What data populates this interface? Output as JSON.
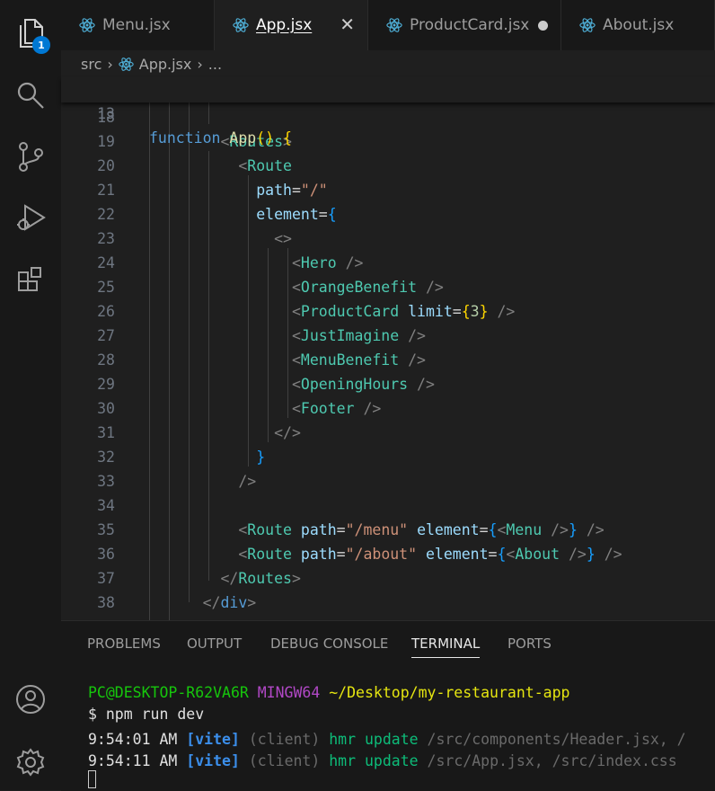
{
  "activity_bar": {
    "explorer_badge": "1"
  },
  "tabs": [
    {
      "label": "Menu.jsx",
      "state": "normal"
    },
    {
      "label": "App.jsx",
      "state": "active"
    },
    {
      "label": "ProductCard.jsx",
      "state": "modified"
    },
    {
      "label": "About.jsx",
      "state": "normal"
    }
  ],
  "breadcrumb": {
    "folder": "src",
    "file": "App.jsx",
    "more": "..."
  },
  "sticky_line": {
    "number": "13",
    "keyword": "function",
    "name": "App",
    "parens": "()",
    "brace": "{"
  },
  "code_lines": [
    {
      "n": "18"
    },
    {
      "n": "19"
    },
    {
      "n": "20"
    },
    {
      "n": "21"
    },
    {
      "n": "22"
    },
    {
      "n": "23"
    },
    {
      "n": "24"
    },
    {
      "n": "25"
    },
    {
      "n": "26"
    },
    {
      "n": "27"
    },
    {
      "n": "28"
    },
    {
      "n": "29"
    },
    {
      "n": "30"
    },
    {
      "n": "31"
    },
    {
      "n": "32"
    },
    {
      "n": "33"
    },
    {
      "n": "34"
    },
    {
      "n": "35"
    },
    {
      "n": "36"
    },
    {
      "n": "37"
    },
    {
      "n": "38"
    }
  ],
  "code": {
    "routes_open": "Routes",
    "route": "Route",
    "path_attr": "path",
    "root_path": "\"/\"",
    "element_attr": "element",
    "hero": "Hero",
    "orange": "OrangeBenefit",
    "product": "ProductCard",
    "limit_attr": "limit",
    "limit_val": "3",
    "imagine": "JustImagine",
    "menu_benefit": "MenuBenefit",
    "opening": "OpeningHours",
    "footer": "Footer",
    "menu_path": "\"/menu\"",
    "menu_comp": "Menu",
    "about_path": "\"/about\"",
    "about_comp": "About",
    "div": "div"
  },
  "panel": {
    "tabs": [
      "PROBLEMS",
      "OUTPUT",
      "DEBUG CONSOLE",
      "TERMINAL",
      "PORTS"
    ],
    "active_tab": "TERMINAL"
  },
  "terminal": {
    "user": "PC@DESKTOP-R62VA6R",
    "shell": "MINGW64",
    "cwd": "~/Desktop/my-restaurant-app",
    "command": "$ npm run dev",
    "logs": [
      {
        "time": "9:54:01 AM",
        "tag": "[vite]",
        "ctx": "(client)",
        "action": "hmr update",
        "files": "/src/components/Header.jsx, /"
      },
      {
        "time": "9:54:11 AM",
        "tag": "[vite]",
        "ctx": "(client)",
        "action": "hmr update",
        "files": "/src/App.jsx, /src/index.css"
      }
    ]
  },
  "colors": {
    "accent": "#0078d4",
    "editor_bg": "#1f1f1f",
    "sidebar_bg": "#181818"
  }
}
